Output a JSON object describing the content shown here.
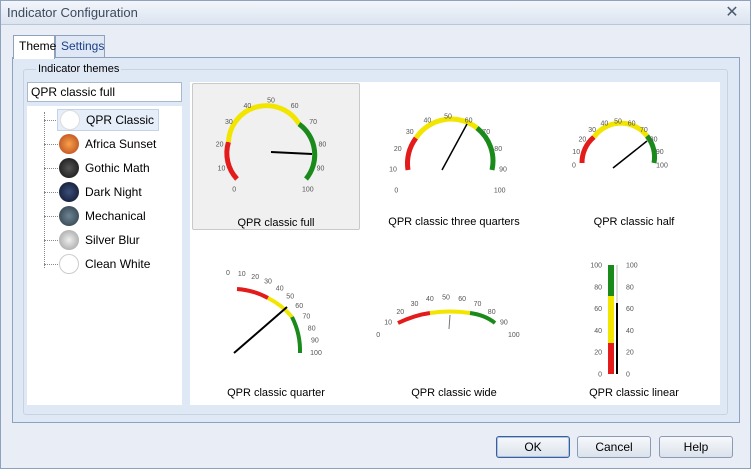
{
  "window": {
    "title": "Indicator Configuration"
  },
  "tabs": [
    {
      "label": "Theme"
    },
    {
      "label": "Settings"
    }
  ],
  "group": {
    "label": "Indicator themes"
  },
  "search": {
    "value": "QPR classic full"
  },
  "themes": [
    {
      "label": "QPR Classic",
      "icon": "qpr-classic-gauge-icon"
    },
    {
      "label": "Africa Sunset",
      "icon": "africa-sunset-gauge-icon"
    },
    {
      "label": "Gothic Math",
      "icon": "gothic-math-gauge-icon"
    },
    {
      "label": "Dark Night",
      "icon": "dark-night-gauge-icon"
    },
    {
      "label": "Mechanical",
      "icon": "mechanical-gauge-icon"
    },
    {
      "label": "Silver Blur",
      "icon": "silver-blur-gauge-icon"
    },
    {
      "label": "Clean White",
      "icon": "clean-white-gauge-icon"
    }
  ],
  "gallery": [
    {
      "label": "QPR classic full"
    },
    {
      "label": "QPR classic three quarters"
    },
    {
      "label": "QPR classic half"
    },
    {
      "label": "QPR classic quarter"
    },
    {
      "label": "QPR classic wide"
    },
    {
      "label": "QPR classic linear"
    }
  ],
  "scale": [
    "0",
    "10",
    "20",
    "30",
    "40",
    "50",
    "60",
    "70",
    "80",
    "90",
    "100"
  ],
  "colors": {
    "red": "#e31b1b",
    "yellow": "#f2e600",
    "green": "#1a8a1a",
    "needle": "#000000"
  },
  "buttons": {
    "ok": "OK",
    "cancel": "Cancel",
    "help": "Help"
  }
}
